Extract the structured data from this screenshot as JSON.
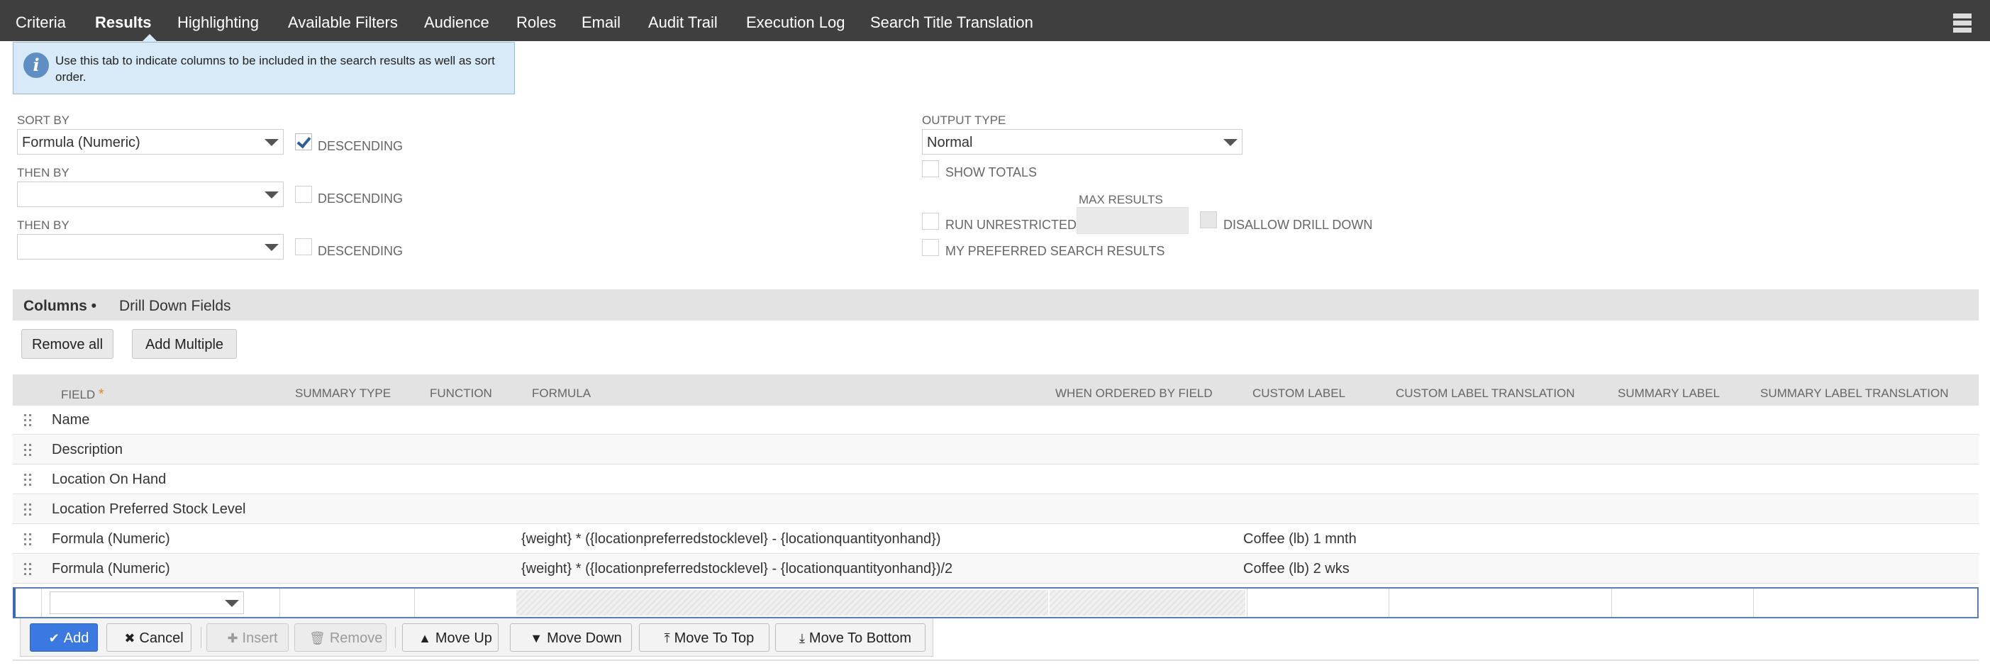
{
  "tabs": [
    {
      "label": "Criteria"
    },
    {
      "label": "Results"
    },
    {
      "label": "Highlighting"
    },
    {
      "label": "Available Filters"
    },
    {
      "label": "Audience"
    },
    {
      "label": "Roles"
    },
    {
      "label": "Email"
    },
    {
      "label": "Audit Trail"
    },
    {
      "label": "Execution Log"
    },
    {
      "label": "Search Title Translation"
    }
  ],
  "active_tab": "Results",
  "info_message": "Use this tab to indicate columns to be included in the search results as well as sort order.",
  "sort": {
    "sort_by_label": "SORT BY",
    "sort_by_value": "Formula (Numeric)",
    "sort_by_descending": true,
    "then_by_label": "THEN BY",
    "then_by_1_value": "",
    "then_by_1_descending": false,
    "then_by_2_value": "",
    "then_by_2_descending": false,
    "descending_label": "DESCENDING"
  },
  "output": {
    "output_type_label": "OUTPUT TYPE",
    "output_type_value": "Normal",
    "show_totals_label": "SHOW TOTALS",
    "max_results_label": "MAX RESULTS",
    "max_results_value": "",
    "run_unrestricted_label": "RUN UNRESTRICTED",
    "disallow_drill_down_label": "DISALLOW DRILL DOWN",
    "my_preferred_label": "MY PREFERRED SEARCH RESULTS"
  },
  "subtabs": [
    {
      "label": "Columns •"
    },
    {
      "label": "Drill Down Fields"
    }
  ],
  "buttons": {
    "remove_all": "Remove all",
    "add_multiple": "Add Multiple"
  },
  "columns_header": {
    "field": "FIELD",
    "required_marker": "*",
    "summary_type": "SUMMARY TYPE",
    "function": "FUNCTION",
    "formula": "FORMULA",
    "when_ordered_by_field": "WHEN ORDERED BY FIELD",
    "custom_label": "CUSTOM LABEL",
    "custom_label_translation": "CUSTOM LABEL TRANSLATION",
    "summary_label": "SUMMARY LABEL",
    "summary_label_translation": "SUMMARY LABEL TRANSLATION"
  },
  "rows": [
    {
      "field": "Name",
      "formula": "",
      "custom_label": ""
    },
    {
      "field": "Description",
      "formula": "",
      "custom_label": ""
    },
    {
      "field": "Location On Hand",
      "formula": "",
      "custom_label": ""
    },
    {
      "field": "Location Preferred Stock Level",
      "formula": "",
      "custom_label": ""
    },
    {
      "field": "Formula (Numeric)",
      "formula": "{weight} * ({locationpreferredstocklevel} - {locationquantityonhand})",
      "custom_label": "Coffee (lb) 1 mnth"
    },
    {
      "field": "Formula (Numeric)",
      "formula": "{weight} * ({locationpreferredstocklevel} - {locationquantityonhand})/2",
      "custom_label": "Coffee (lb) 2 wks"
    }
  ],
  "actions": {
    "add": "Add",
    "cancel": "Cancel",
    "insert": "Insert",
    "remove": "Remove",
    "move_up": "Move Up",
    "move_down": "Move Down",
    "move_to_top": "Move To Top",
    "move_to_bottom": "Move To Bottom"
  },
  "colors": {
    "topbar": "#3f3f3f",
    "info_bg": "#d8eaf7",
    "primary_button": "#3b78e0"
  }
}
